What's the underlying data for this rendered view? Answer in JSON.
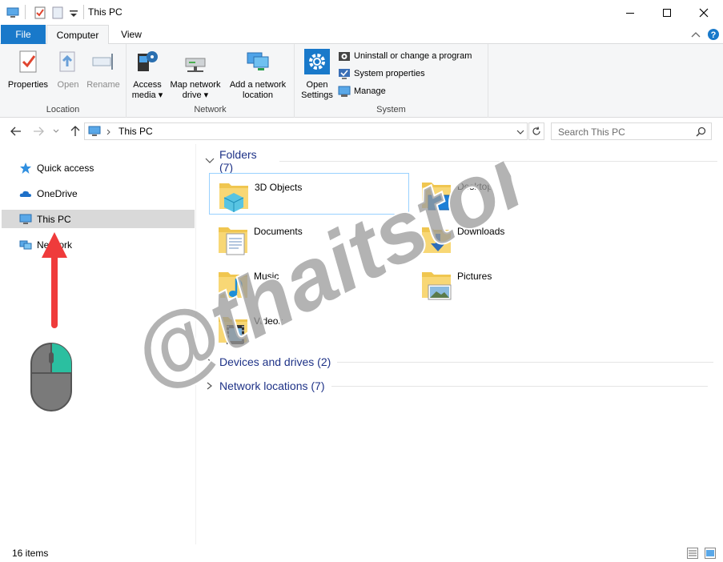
{
  "window": {
    "title": "This PC"
  },
  "tabs": [
    {
      "label": "File"
    },
    {
      "label": "Computer"
    },
    {
      "label": "View"
    }
  ],
  "ribbon": {
    "location": {
      "label": "Location",
      "properties": "Properties",
      "open": "Open",
      "rename": "Rename"
    },
    "network": {
      "label": "Network",
      "access_media_1": "Access",
      "access_media_2": "media",
      "map_drive_1": "Map network",
      "map_drive_2": "drive",
      "add_location_1": "Add a network",
      "add_location_2": "location"
    },
    "system": {
      "label": "System",
      "open_settings_1": "Open",
      "open_settings_2": "Settings",
      "uninstall": "Uninstall or change a program",
      "system_properties": "System properties",
      "manage": "Manage"
    }
  },
  "address": {
    "path": "This PC",
    "search_placeholder": "Search This PC"
  },
  "nav": {
    "items": [
      {
        "label": "Quick access"
      },
      {
        "label": "OneDrive"
      },
      {
        "label": "This PC"
      },
      {
        "label": "Network"
      }
    ]
  },
  "content": {
    "folders_header": "Folders (7)",
    "devices_header": "Devices and drives (2)",
    "network_header": "Network locations (7)",
    "folders": [
      {
        "name": "3D Objects"
      },
      {
        "name": "Desktop"
      },
      {
        "name": "Documents"
      },
      {
        "name": "Downloads"
      },
      {
        "name": "Music"
      },
      {
        "name": "Pictures"
      },
      {
        "name": "Videos"
      }
    ]
  },
  "status": {
    "count": "16 items"
  },
  "watermark": {
    "text": "@thaitstore"
  },
  "colors": {
    "accent": "#1979ca",
    "folder": "#f8d775",
    "header_text": "#1e3287",
    "arrow": "#ef3b3b",
    "mouse_body": "#7a7a7a",
    "mouse_button": "#2bbfa0"
  }
}
